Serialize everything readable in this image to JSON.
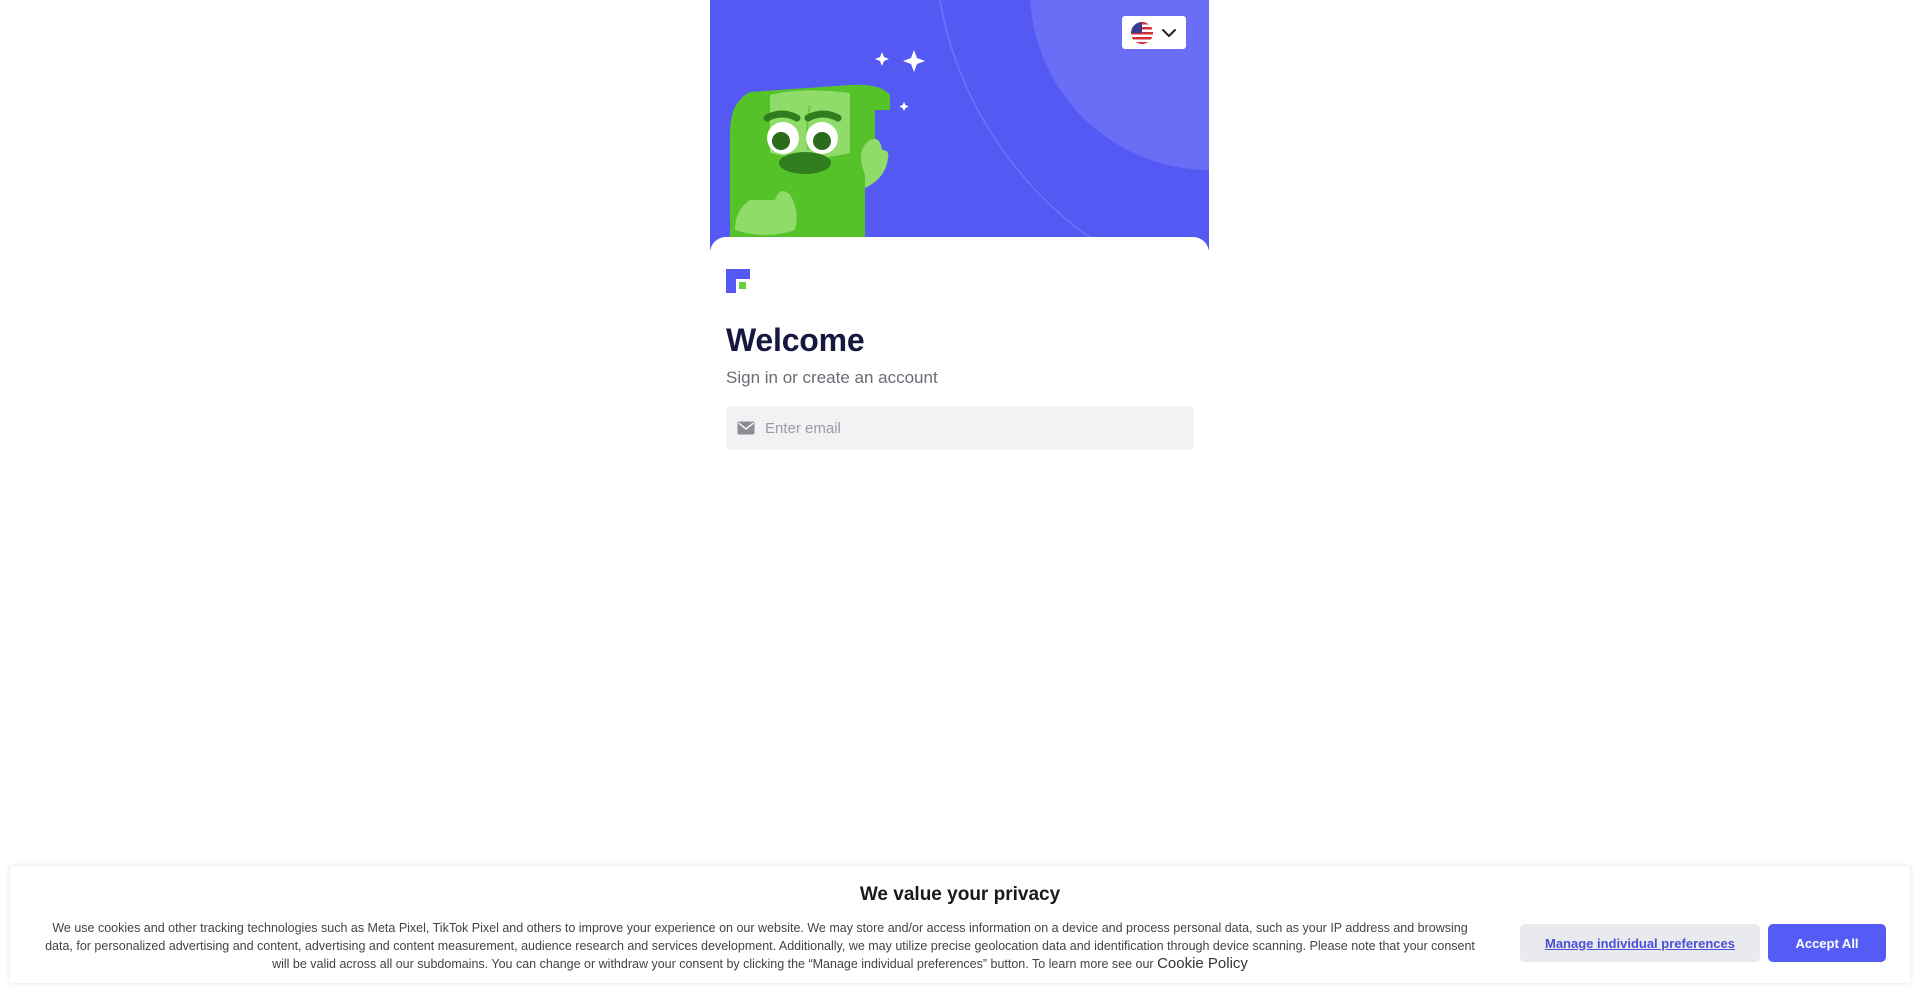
{
  "header": {
    "language_selector": {
      "icon": "us-flag-icon",
      "dropdown_icon": "chevron-down-icon"
    },
    "mascot": "mascot-illustration"
  },
  "main": {
    "logo": "brand-logo-icon",
    "title": "Welcome",
    "subtitle": "Sign in or create an account",
    "email": {
      "icon": "mail-icon",
      "placeholder": "Enter email",
      "value": ""
    }
  },
  "cookie_banner": {
    "title": "We value your privacy",
    "text": "We use cookies and other tracking technologies such as Meta Pixel, TikTok Pixel and others to improve your experience on our website. We may store and/or access information on a device and process personal data, such as your IP address and browsing data, for personalized advertising and content, advertising and content measurement, audience research and services development. Additionally, we may utilize precise geolocation data and identification through device scanning.  Please note that your consent will be valid across all our subdomains. You can change or withdraw your consent by clicking the “Manage individual preferences” button. To learn more see our",
    "policy_link": "Cookie Policy",
    "manage_label": "Manage individual preferences",
    "accept_label": "Accept All"
  },
  "colors": {
    "brand": "#5459f4",
    "title": "#17173f",
    "accent_green": "#6ccb3f"
  }
}
